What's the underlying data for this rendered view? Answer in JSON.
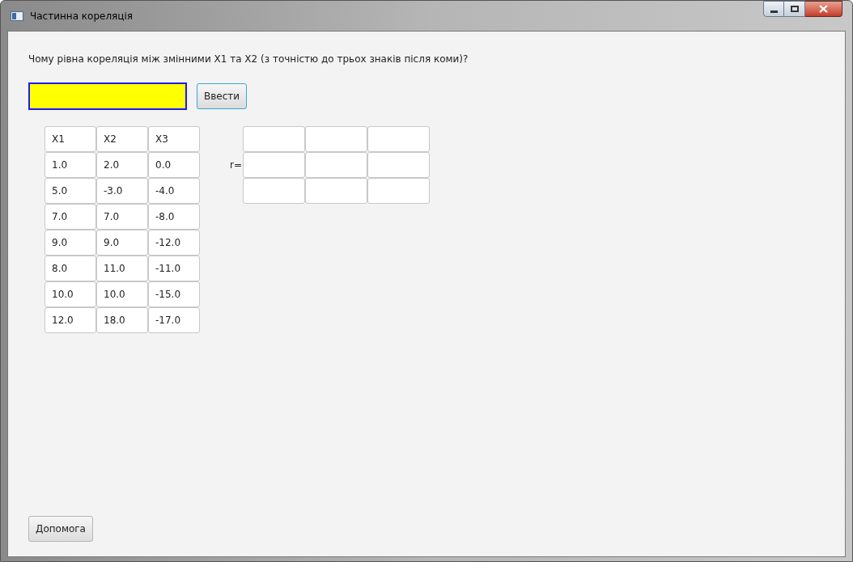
{
  "window": {
    "title": "Частинна кореляція"
  },
  "question": "Чому рівна кореляція між змінними X1 та X2 (з точністю до трьох знаків після коми)?",
  "answer_field": {
    "highlighted": true
  },
  "submit_button": "Ввести",
  "table": {
    "columns": [
      "X1",
      "X2",
      "X3"
    ],
    "rows": [
      [
        "1.0",
        "2.0",
        "0.0"
      ],
      [
        "5.0",
        "-3.0",
        "-4.0"
      ],
      [
        "7.0",
        "7.0",
        "-8.0"
      ],
      [
        "9.0",
        "9.0",
        "-12.0"
      ],
      [
        "8.0",
        "11.0",
        "-11.0"
      ],
      [
        "10.0",
        "10.0",
        "-15.0"
      ],
      [
        "12.0",
        "18.0",
        "-17.0"
      ]
    ]
  },
  "matrix": {
    "label": "r=",
    "rows": [
      {
        "cells": [
          {
            "kind": "blank"
          },
          {
            "kind": "blank"
          },
          {
            "kind": "blank"
          }
        ]
      },
      {
        "cells": [
          {
            "kind": "blank"
          },
          {
            "kind": "blank"
          },
          {
            "kind": "blank"
          }
        ]
      },
      {
        "cells": [
          {
            "kind": "blank"
          },
          {
            "kind": "blank"
          },
          {
            "kind": "blank"
          }
        ]
      }
    ]
  },
  "help_button": "Допомога"
}
